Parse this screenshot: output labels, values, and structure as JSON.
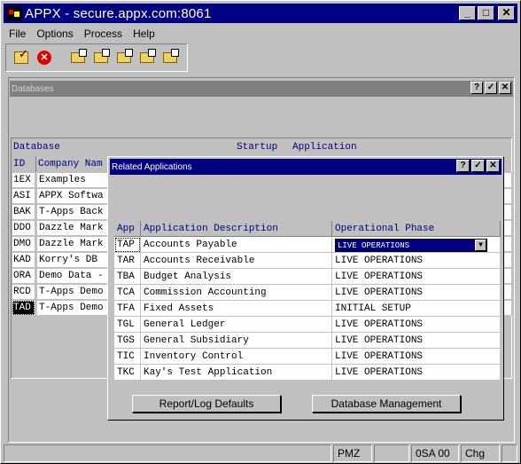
{
  "window": {
    "title": "APPX - secure.appx.com:8061"
  },
  "menu": [
    "File",
    "Options",
    "Process",
    "Help"
  ],
  "toolbar": {
    "tools": [
      "checkmark-folder-icon",
      "stop-icon",
      "new-folder-icon",
      "open-folder-icon",
      "search-folder-icon",
      "remove-folder-icon",
      "edit-folder-icon"
    ]
  },
  "databases": {
    "title": "Databases",
    "header_label": "Database",
    "header_startup": "Startup",
    "header_application": "Application",
    "col_id": "ID",
    "col_company": "Company Nam",
    "rows": [
      {
        "id": "1EX",
        "name": "Examples"
      },
      {
        "id": "ASI",
        "name": "APPX Softwa"
      },
      {
        "id": "BAK",
        "name": "T-Apps Back"
      },
      {
        "id": "DDO",
        "name": "Dazzle Mark"
      },
      {
        "id": "DMO",
        "name": "Dazzle Mark"
      },
      {
        "id": "KAD",
        "name": "Korry's DB"
      },
      {
        "id": "ORA",
        "name": "Demo Data -"
      },
      {
        "id": "RCD",
        "name": "T-Apps Demo"
      },
      {
        "id": "TAD",
        "name": "T-Apps Demo"
      }
    ]
  },
  "related": {
    "title": "Related Applications",
    "columns": [
      "App",
      "Application Description",
      "Operational Phase"
    ],
    "rows": [
      {
        "app": "TAP",
        "desc": "Accounts Payable",
        "phase": "LIVE OPERATIONS"
      },
      {
        "app": "TAR",
        "desc": "Accounts Receivable",
        "phase": "LIVE OPERATIONS"
      },
      {
        "app": "TBA",
        "desc": "Budget Analysis",
        "phase": "LIVE OPERATIONS"
      },
      {
        "app": "TCA",
        "desc": "Commission Accounting",
        "phase": "LIVE OPERATIONS"
      },
      {
        "app": "TFA",
        "desc": "Fixed Assets",
        "phase": "INITIAL SETUP"
      },
      {
        "app": "TGL",
        "desc": "General Ledger",
        "phase": "LIVE OPERATIONS"
      },
      {
        "app": "TGS",
        "desc": "General Subsidiary",
        "phase": "LIVE OPERATIONS"
      },
      {
        "app": "TIC",
        "desc": "Inventory Control",
        "phase": "LIVE OPERATIONS"
      },
      {
        "app": "TKC",
        "desc": "Kay's Test Application",
        "phase": "LIVE OPERATIONS"
      }
    ],
    "selected_phase": "LIVE OPERATIONS",
    "btn_report": "Report/Log Defaults",
    "btn_dbmgmt": "Database Management"
  },
  "status": {
    "cell1": "PMZ",
    "cell2": "0SA 00",
    "cell3": "Chg"
  }
}
